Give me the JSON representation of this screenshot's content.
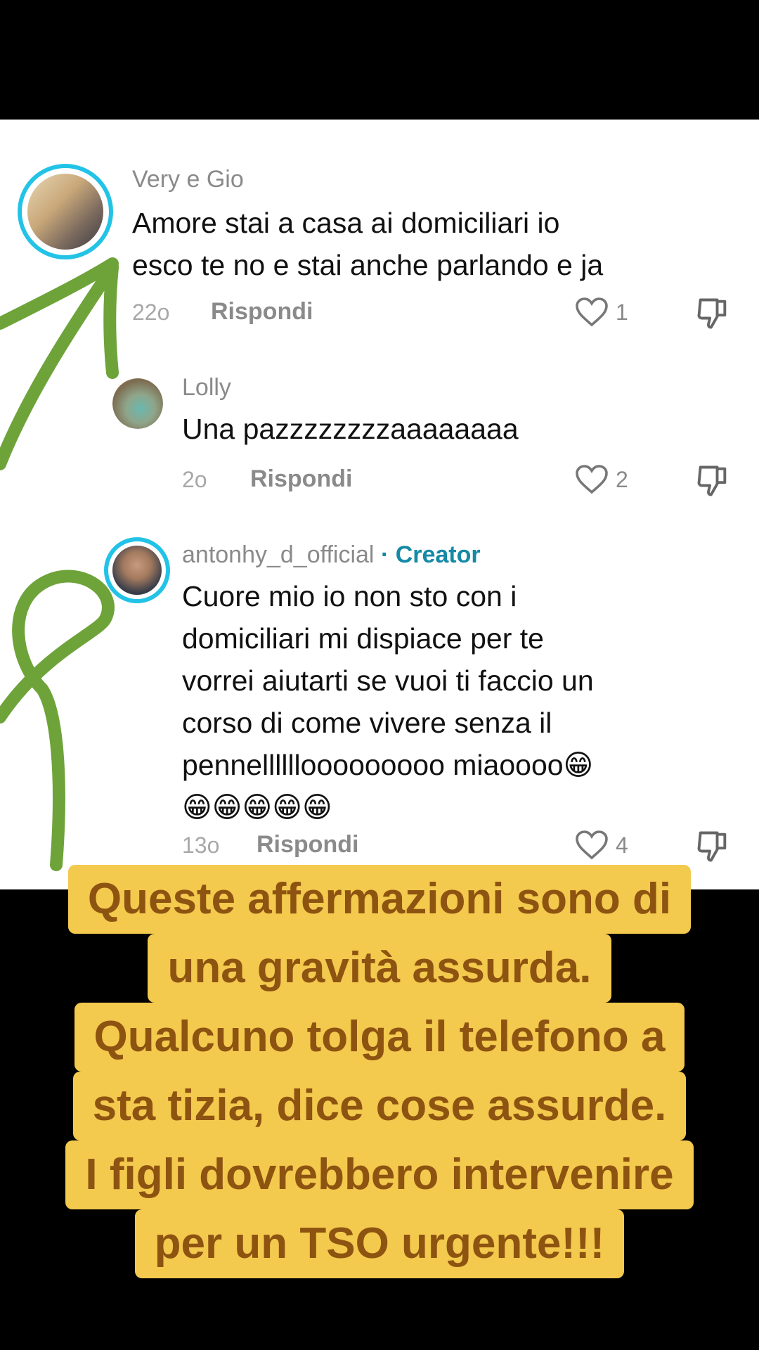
{
  "comments": [
    {
      "username": "Very e Gio",
      "text_lines": [
        "Amore stai a casa ai domiciliari io",
        "esco te no e stai anche parlando e ja"
      ],
      "time": "22o",
      "reply_label": "Rispondi",
      "likes": "1"
    },
    {
      "username": "Lolly",
      "text_lines": [
        "Una pazzzzzzzzaaaaaaaa"
      ],
      "time": "2o",
      "reply_label": "Rispondi",
      "likes": "2"
    },
    {
      "username": "antonhy_d_official",
      "creator_label": "· Creator",
      "text_lines": [
        "Cuore mio io non sto con i",
        "domiciliari mi dispiace per te",
        "vorrei aiutarti se vuoi ti faccio un",
        "corso di come vivere senza il",
        "pennellllllooooooooo miaoooo😁",
        "😁😁😁😁😁"
      ],
      "time": "13o",
      "reply_label": "Rispondi",
      "likes": "4"
    }
  ],
  "caption_lines": [
    "Queste affermazioni sono di",
    "una gravità assurda.",
    "Qualcuno tolga il telefono a",
    "sta tizia, dice cose assurde.",
    "I figli dovrebbero intervenire",
    "per un TSO urgente!!!"
  ],
  "icons": {
    "like": "heart-outline-icon",
    "dislike": "thumbs-down-icon"
  },
  "colors": {
    "caption_bg": "#f3c94e",
    "caption_text": "#8d5310",
    "creator": "#138aa6",
    "avatar_ring": "#22c3e6",
    "arrow": "#6ea33a"
  }
}
